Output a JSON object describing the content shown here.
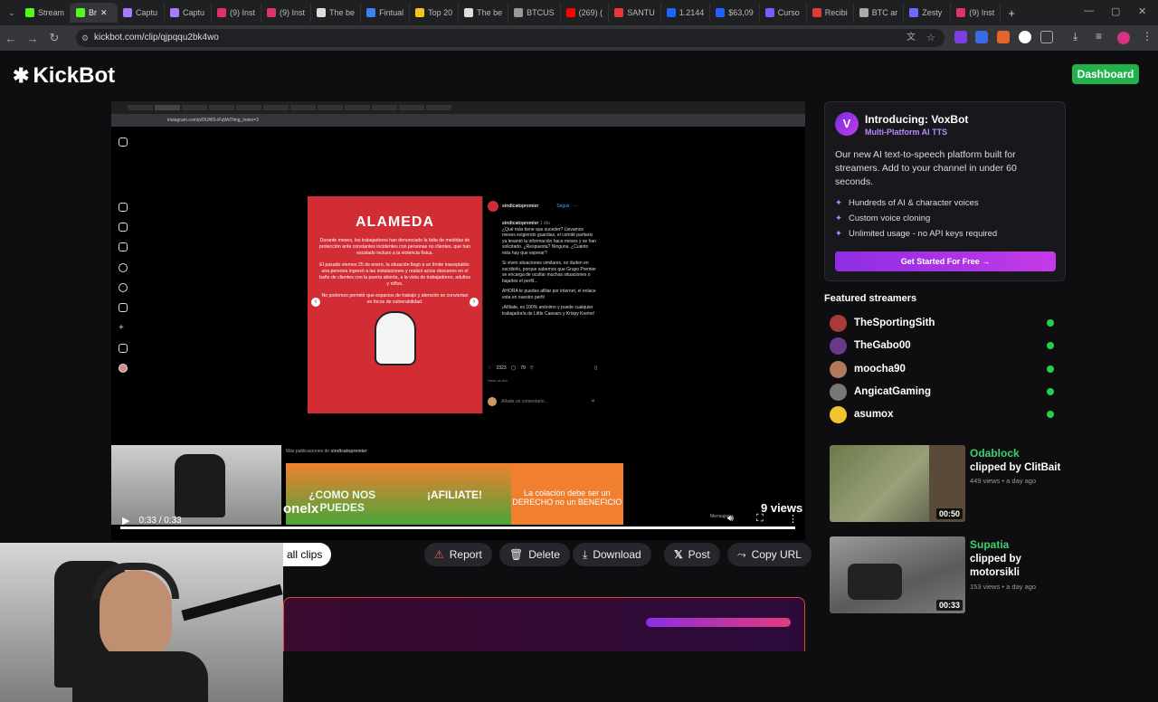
{
  "browser": {
    "tabs": [
      "Stream",
      "Br",
      "Captu",
      "Captu",
      "(9) Inst",
      "(9) Inst",
      "The be",
      "Fintual",
      "Top 20",
      "The be",
      "BTCUS",
      "(269) (",
      "SANTU",
      "1.2144",
      "$63,09",
      "Curso",
      "Recibi",
      "BTC ar",
      "Zesty",
      "(9) Inst"
    ],
    "url": "kickbot.com/clip/qjpqqu2bk4wo"
  },
  "site": {
    "logo_text": "KickBot",
    "dashboard_label": "Dashboard"
  },
  "player": {
    "inner_url": "instagram.com/p/DUWS-iFqWd?img_index=2",
    "post": {
      "headline": "ALAMEDA",
      "para1": "Durante meses, los trabajadores han denunciado la falta de medidas de protección ante constantes incidentes con personas no clientes, que han escalado incluso a la violencia física.",
      "para2": "El pasado viernes 25 de enero, la situación llegó a un límite inaceptable: una persona ingresó a las instalaciones y realizó actos obscenos en el baño de clientes con la puerta abierta, a la vista de trabajadores, adultos y niños.",
      "para3": "No podemos permitir que espacios de trabajo y atención se conviertan en focos de vulnerabilidad.",
      "account": "sindicatopremier",
      "follow": "Seguir",
      "caption_time": "1 día",
      "caption1": "¿Qué más tiene que suceder? Llevamos meses exigiendo guardias, el comité paritario ya levantó la información hace meses y se han solicitado. ¿Respuesta? Ninguna. ¿Cuánto más hay que esperar?",
      "caption2": "Si viven situaciones similares, no duden en escribirlo, porque sabemos que Grupo Premier se encarga de ocultar muchas situaciones o bajarles el perfil...",
      "caption3": "AHORA te puedes afiliar por internet, el enlace esta en nuestro perfil",
      "caption4": "¡Afíliate, es 100% anónimo y puede cualquier trabajador/a de Little Caesars y Krispy Kreme!",
      "likes": "2323",
      "comments": "79",
      "ago": "Hace un día",
      "comment_placeholder": "Añade un comentario...",
      "more_label": "Más publicaciones de",
      "strip": [
        "¿COMO NOS PUEDES",
        "¡AFILIATE!",
        "La colación debe ser un DERECHO no un BENEFICIO"
      ],
      "messages_label": "Mensajes"
    },
    "time": "0:33 / 0:33"
  },
  "clip": {
    "title_fragment": "onelx",
    "views": "9 views",
    "all_clips": "all clips",
    "actions": {
      "report": "Report",
      "delete": "Delete",
      "download": "Download",
      "post": "Post",
      "copy_url": "Copy URL"
    }
  },
  "promo": {
    "title": "Introducing: VoxBot",
    "subtitle": "Multi-Platform AI TTS",
    "description": "Our new AI text-to-speech platform built for streamers. Add to your channel in under 60 seconds.",
    "bullets": [
      "Hundreds of AI & character voices",
      "Custom voice cloning",
      "Unlimited usage - no API keys required"
    ],
    "cta": "Get Started For Free →",
    "colors": {
      "accent": "#8e2de2",
      "kick_green": "#53fc18"
    }
  },
  "featured": {
    "title": "Featured streamers",
    "streamers": [
      "TheSportingSith",
      "TheGabo00",
      "moocha90",
      "AngicatGaming",
      "asumox"
    ]
  },
  "clips": [
    {
      "name": "Odablock",
      "by": "clipped by ClitBait",
      "meta": "449 views • a day ago",
      "duration": "00:50"
    },
    {
      "name": "Supatia",
      "by": "clipped by motorsikli",
      "meta": "153 views • a day ago",
      "duration": "00:33"
    }
  ]
}
